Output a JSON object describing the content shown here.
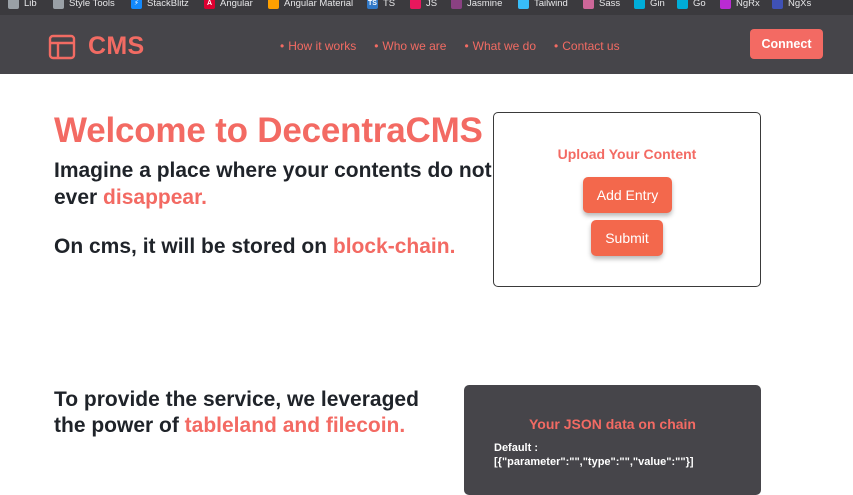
{
  "bookmarks": [
    {
      "label": "Lib",
      "icon": "folder-icon",
      "color": "#9aa0a6"
    },
    {
      "label": "Style Tools",
      "icon": "folder-icon",
      "color": "#9aa0a6"
    },
    {
      "label": "StackBlitz",
      "icon": "stackblitz-icon",
      "color": "#1389fd"
    },
    {
      "label": "Angular",
      "icon": "angular-icon",
      "color": "#dd0031"
    },
    {
      "label": "Angular Material",
      "icon": "angular-material-icon",
      "color": "#ffa000"
    },
    {
      "label": "TS",
      "icon": "typescript-icon",
      "color": "#3178c6"
    },
    {
      "label": "JS",
      "icon": "js-icon",
      "color": "#e8175d"
    },
    {
      "label": "Jasmine",
      "icon": "jasmine-icon",
      "color": "#8a4182"
    },
    {
      "label": "Tailwind",
      "icon": "tailwind-icon",
      "color": "#38bdf8"
    },
    {
      "label": "Sass",
      "icon": "sass-icon",
      "color": "#cd6799"
    },
    {
      "label": "Gin",
      "icon": "gin-icon",
      "color": "#00add8"
    },
    {
      "label": "Go",
      "icon": "go-icon",
      "color": "#00add8"
    },
    {
      "label": "NgRx",
      "icon": "ngrx-icon",
      "color": "#ba2bd2"
    },
    {
      "label": "NgXs",
      "icon": "ngxs-icon",
      "color": "#3f51b5"
    }
  ],
  "navbar": {
    "brand": "CMS",
    "brand_icon": "layout-icon",
    "links": [
      "How it works",
      "Who we are",
      "What we do",
      "Contact us"
    ],
    "connect_label": "Connect"
  },
  "hero": {
    "title": "Welcome to DecentraCMS",
    "line1_prefix": "Imagine a place where your contents do not ever ",
    "line1_accent": "disappear.",
    "line2_prefix": "On cms, it will be stored on ",
    "line2_accent": "block-chain."
  },
  "upload": {
    "title": "Upload Your Content",
    "add_entry_label": "Add Entry",
    "submit_label": "Submit"
  },
  "service": {
    "prefix": "To provide the service, we leveraged the power of ",
    "accent": "tableland and filecoin."
  },
  "json_card": {
    "title": "Your JSON data on chain",
    "default_label": "Default :",
    "default_value": "[{\"parameter\":\"\",\"type\":\"\",\"value\":\"\"}]"
  },
  "colors": {
    "accent": "#f36a63",
    "button": "#f3684c",
    "navbar_bg": "#46454a",
    "text_dark": "#1f2329"
  }
}
